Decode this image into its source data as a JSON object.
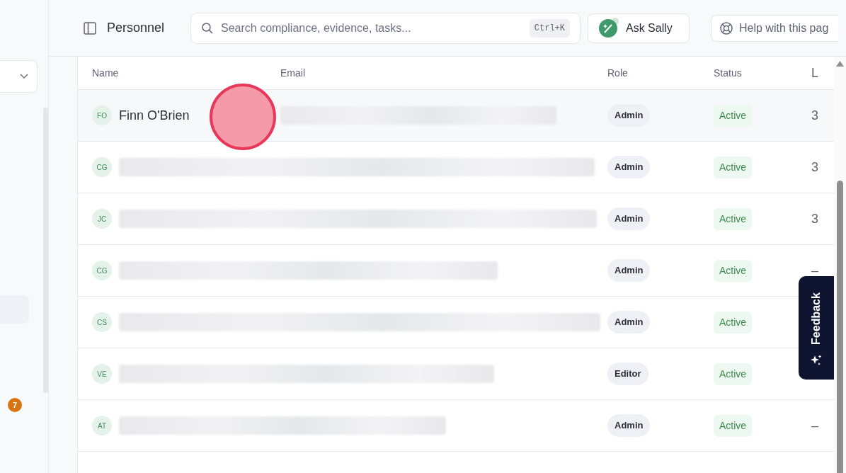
{
  "sidebar": {
    "badge": "7"
  },
  "header": {
    "title": "Personnel",
    "search": {
      "placeholder": "Search compliance, evidence, tasks...",
      "shortcut": "Ctrl+K"
    },
    "ask_button": "Ask Sally",
    "help_button": "Help with this pag"
  },
  "table": {
    "columns": [
      "Name",
      "Email",
      "Role",
      "Status",
      "L"
    ],
    "rows": [
      {
        "initials": "FO",
        "name": "Finn O'Brien",
        "role": "Admin",
        "status": "Active",
        "column_5": "3"
      },
      {
        "initials": "CG",
        "role": "Admin",
        "status": "Active",
        "column_5": "3"
      },
      {
        "initials": "JC",
        "role": "Admin",
        "status": "Active",
        "column_5": "3"
      },
      {
        "initials": "CG",
        "role": "Admin",
        "status": "Active",
        "column_5": "–"
      },
      {
        "initials": "CS",
        "role": "Admin",
        "status": "Active"
      },
      {
        "initials": "VE",
        "role": "Editor",
        "status": "Active"
      },
      {
        "initials": "AT",
        "role": "Admin",
        "status": "Active",
        "column_5": "–"
      }
    ]
  },
  "feedback_tab": "Feedback"
}
